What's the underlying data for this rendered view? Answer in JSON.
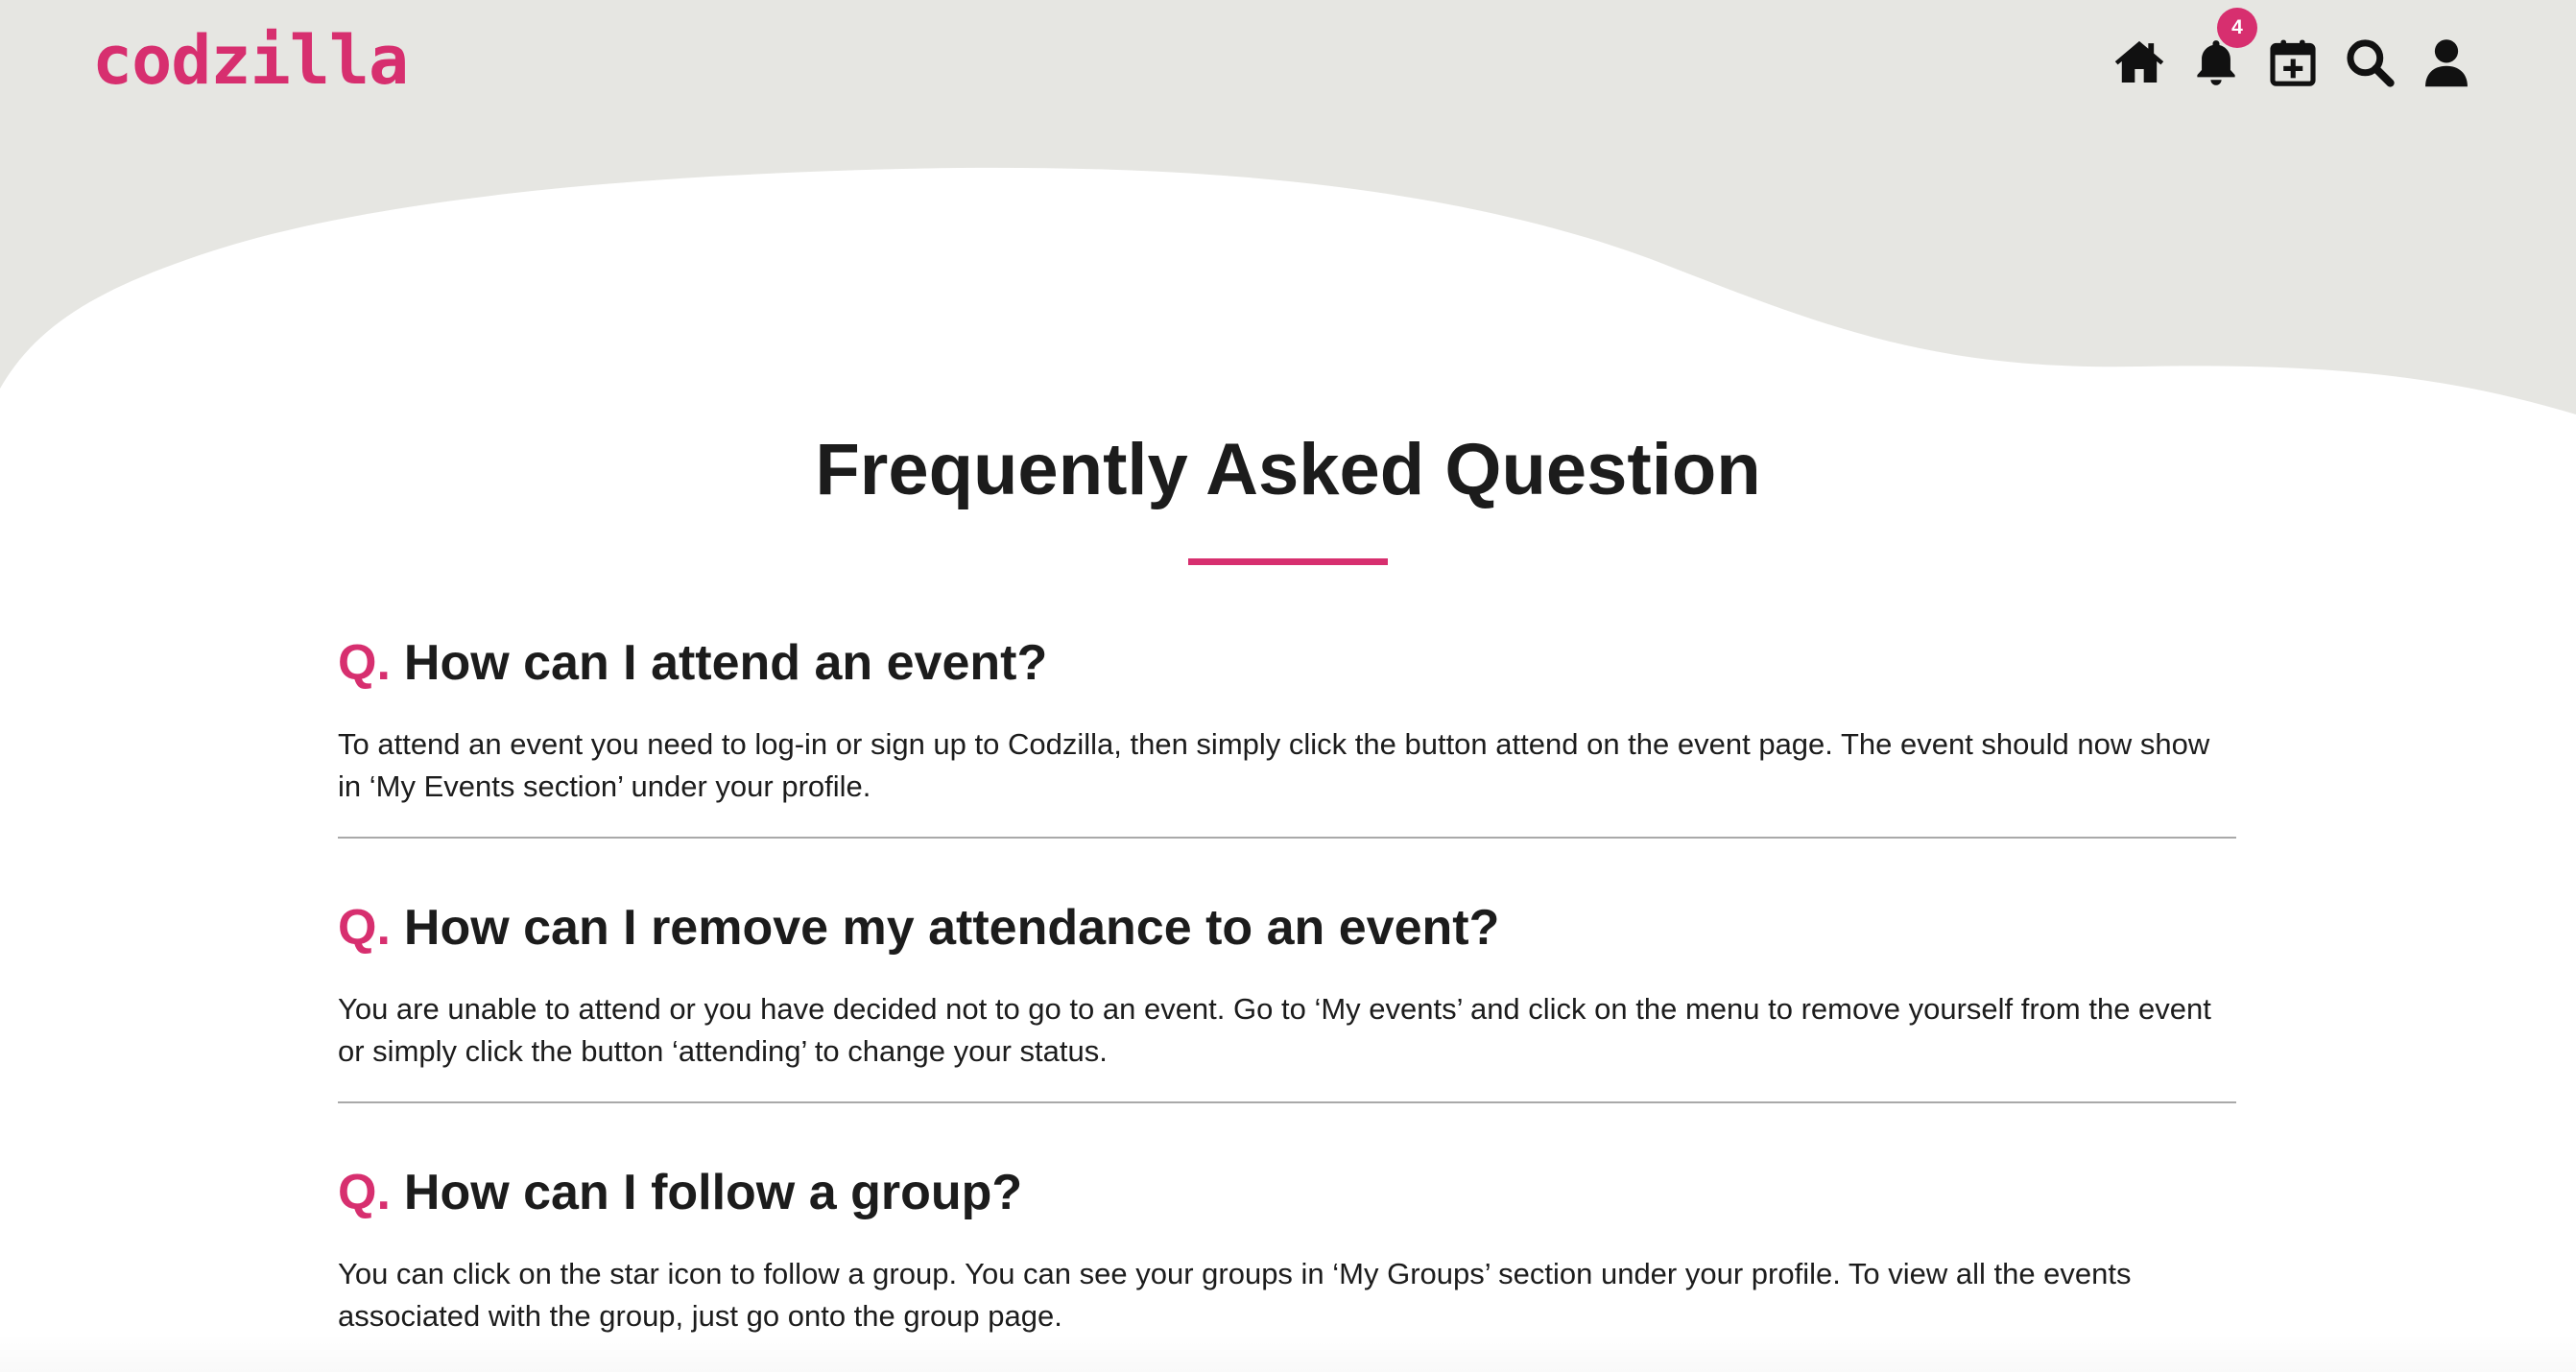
{
  "app": {
    "logo_text": "codzilla"
  },
  "colors": {
    "accent": "#d72f6f",
    "header_bg": "#e6e6e2",
    "text": "#1c1c1c",
    "divider": "#a9a9a9"
  },
  "nav": {
    "icons": [
      "home-icon",
      "bell-icon",
      "calendar-plus-icon",
      "search-icon",
      "user-icon"
    ],
    "notification_count": "4"
  },
  "page": {
    "title": "Frequently Asked Question"
  },
  "faq": [
    {
      "prefix": "Q.",
      "question": "How can I attend an event?",
      "answer": "To attend an event you need to log-in or sign up to Codzilla, then simply click the button attend on the event page. The event should now show in ‘My Events section’ under your profile."
    },
    {
      "prefix": "Q.",
      "question": "How can I remove my attendance to an event?",
      "answer": "You are unable to attend or you have decided not to go to an event. Go to ‘My events’ and click on the menu to remove yourself from the event or simply click the button ‘attending’ to change your status."
    },
    {
      "prefix": "Q.",
      "question": "How can I follow a group?",
      "answer": "You can click on the star icon to follow a group. You can see your groups in ‘My Groups’ section under your profile. To view all the events associated with the group, just go onto the group page."
    }
  ]
}
